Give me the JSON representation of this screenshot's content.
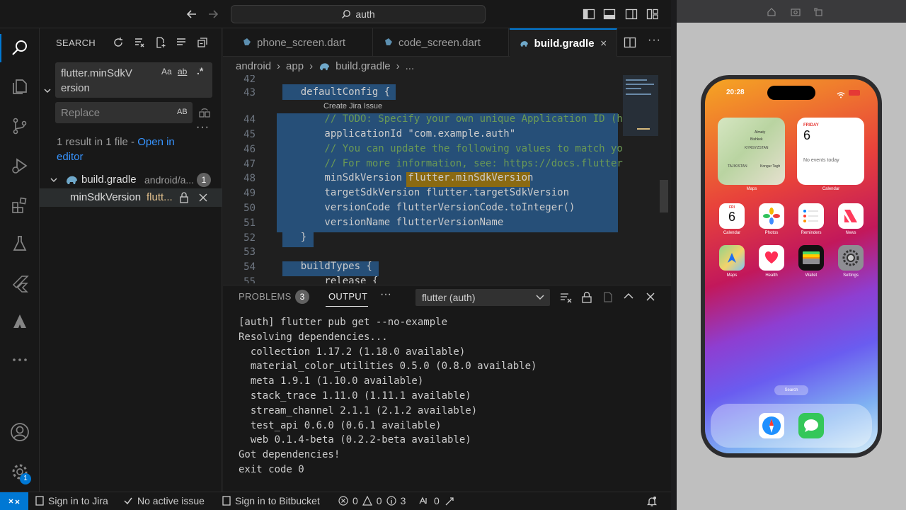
{
  "titlebar": {
    "search_text": "auth"
  },
  "sidebar": {
    "title": "SEARCH",
    "search_value": "flutter.minSdkVersion",
    "search_line1": "flutter.minSdkV",
    "search_line2": "ersion",
    "opt_case": "Aa",
    "opt_word": "ab",
    "opt_regex": ".*",
    "replace_placeholder": "Replace",
    "replace_opt": "AB",
    "result_summary": "1 result in 1 file - ",
    "open_in_editor_1": "Open in",
    "open_in_editor_2": "editor",
    "file_name": "build.gradle",
    "file_path": "android/a...",
    "file_count": "1",
    "match_prefix": "minSdkVersion ",
    "match_hit": "flutt..."
  },
  "tabs": [
    {
      "label": "phone_screen.dart"
    },
    {
      "label": "code_screen.dart"
    },
    {
      "label": "build.gradle"
    }
  ],
  "breadcrumb": [
    "android",
    "app",
    "build.gradle",
    "..."
  ],
  "code": {
    "hover": "Create Jira Issue",
    "lines": [
      {
        "n": "42",
        "t": ""
      },
      {
        "n": "43",
        "t": "    defaultConfig {"
      },
      {
        "n": "44",
        "t": "        // TODO: Specify your own unique Application ID (h"
      },
      {
        "n": "45",
        "t": "        applicationId \"com.example.auth\""
      },
      {
        "n": "46",
        "t": "        // You can update the following values to match yo"
      },
      {
        "n": "47",
        "t": "        // For more information, see: https://docs.flutter"
      },
      {
        "n": "48",
        "t": "        minSdkVersion flutter.minSdkVersion"
      },
      {
        "n": "49",
        "t": "        targetSdkVersion flutter.targetSdkVersion"
      },
      {
        "n": "50",
        "t": "        versionCode flutterVersionCode.toInteger()"
      },
      {
        "n": "51",
        "t": "        versionName flutterVersionName"
      },
      {
        "n": "52",
        "t": "    }"
      },
      {
        "n": "53",
        "t": ""
      },
      {
        "n": "54",
        "t": "    buildTypes {"
      },
      {
        "n": "55",
        "t": "        release {"
      }
    ]
  },
  "panel": {
    "tab_problems": "PROBLEMS",
    "problems_count": "3",
    "tab_output": "OUTPUT",
    "more": "···",
    "channel": "flutter (auth)",
    "output": "[auth] flutter pub get --no-example\nResolving dependencies...\n  collection 1.17.2 (1.18.0 available)\n  material_color_utilities 0.5.0 (0.8.0 available)\n  meta 1.9.1 (1.10.0 available)\n  stack_trace 1.11.0 (1.11.1 available)\n  stream_channel 2.1.1 (2.1.2 available)\n  test_api 0.6.0 (0.6.1 available)\n  web 0.1.4-beta (0.2.2-beta available)\nGot dependencies!\nexit code 0"
  },
  "status": {
    "jira": "Sign in to Jira",
    "issue": "No active issue",
    "bitbucket": "Sign in to Bitbucket",
    "errors": "0",
    "warnings": "0",
    "info": "3",
    "ports": "0"
  },
  "activity": {
    "badge": "1"
  },
  "phone": {
    "time": "20:28",
    "map_labels": [
      "Almaty",
      "Bishkek",
      "KYRGYZSTAN",
      "TAJIKISTAN",
      "Kongur Tagh"
    ],
    "widget_maps": "Maps",
    "cal_day": "FRIDAY",
    "cal_date": "6",
    "cal_empty": "No events today",
    "widget_calendar": "Calendar",
    "calicon_day": "FRI",
    "calicon_date": "6",
    "apps_row1": [
      "Calendar",
      "Photos",
      "Reminders",
      "News"
    ],
    "apps_row2": [
      "Maps",
      "Health",
      "Wallet",
      "Settings"
    ],
    "search_pill": "Search"
  },
  "colors": {
    "accent": "#0078d4",
    "selection": "#264f78",
    "match": "#8a6a12"
  }
}
